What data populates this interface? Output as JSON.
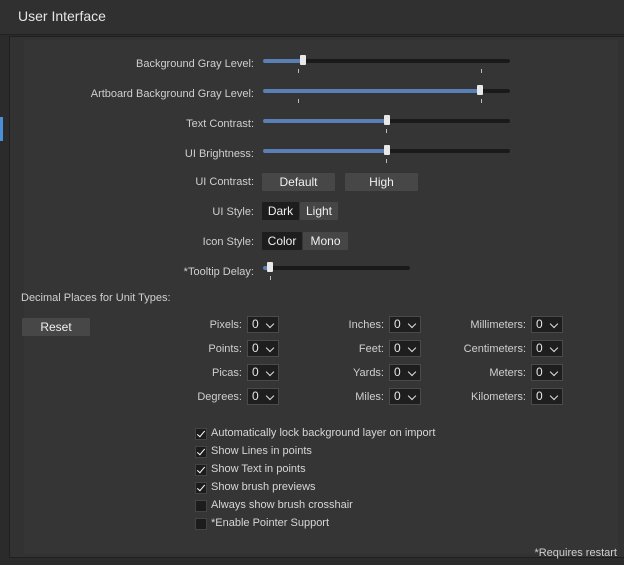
{
  "window": {
    "title": "User Interface"
  },
  "sliders": [
    {
      "label": "Background Gray Level:",
      "value": 0.16
    },
    {
      "label": "Artboard Background Gray Level:",
      "value": 0.88
    },
    {
      "label": "Text Contrast:",
      "value": 0.5
    },
    {
      "label": "UI Brightness:",
      "value": 0.5
    },
    {
      "label": "*Tooltip Delay:",
      "value": 0.05
    }
  ],
  "ui_contrast": {
    "label": "UI Contrast:",
    "options": [
      "Default",
      "High"
    ],
    "selected": "Default"
  },
  "ui_style": {
    "label": "UI Style:",
    "options": [
      "Dark",
      "Light"
    ],
    "selected": "Dark"
  },
  "icon_style": {
    "label": "Icon Style:",
    "options": [
      "Color",
      "Mono"
    ],
    "selected": "Color"
  },
  "decimal": {
    "title": "Decimal Places for Unit Types:",
    "reset_label": "Reset",
    "units": [
      {
        "label": "Pixels:",
        "value": "0"
      },
      {
        "label": "Points:",
        "value": "0"
      },
      {
        "label": "Picas:",
        "value": "0"
      },
      {
        "label": "Degrees:",
        "value": "0"
      },
      {
        "label": "Inches:",
        "value": "0"
      },
      {
        "label": "Feet:",
        "value": "0"
      },
      {
        "label": "Yards:",
        "value": "0"
      },
      {
        "label": "Miles:",
        "value": "0"
      },
      {
        "label": "Millimeters:",
        "value": "0"
      },
      {
        "label": "Centimeters:",
        "value": "0"
      },
      {
        "label": "Meters:",
        "value": "0"
      },
      {
        "label": "Kilometers:",
        "value": "0"
      }
    ]
  },
  "checkboxes": [
    {
      "label": "Automatically lock background layer on import",
      "checked": true
    },
    {
      "label": "Show Lines in points",
      "checked": true
    },
    {
      "label": "Show Text in points",
      "checked": true
    },
    {
      "label": "Show brush previews",
      "checked": true
    },
    {
      "label": "Always show brush crosshair",
      "checked": false
    },
    {
      "label": "*Enable Pointer Support",
      "checked": false
    }
  ],
  "footnote": "*Requires restart"
}
